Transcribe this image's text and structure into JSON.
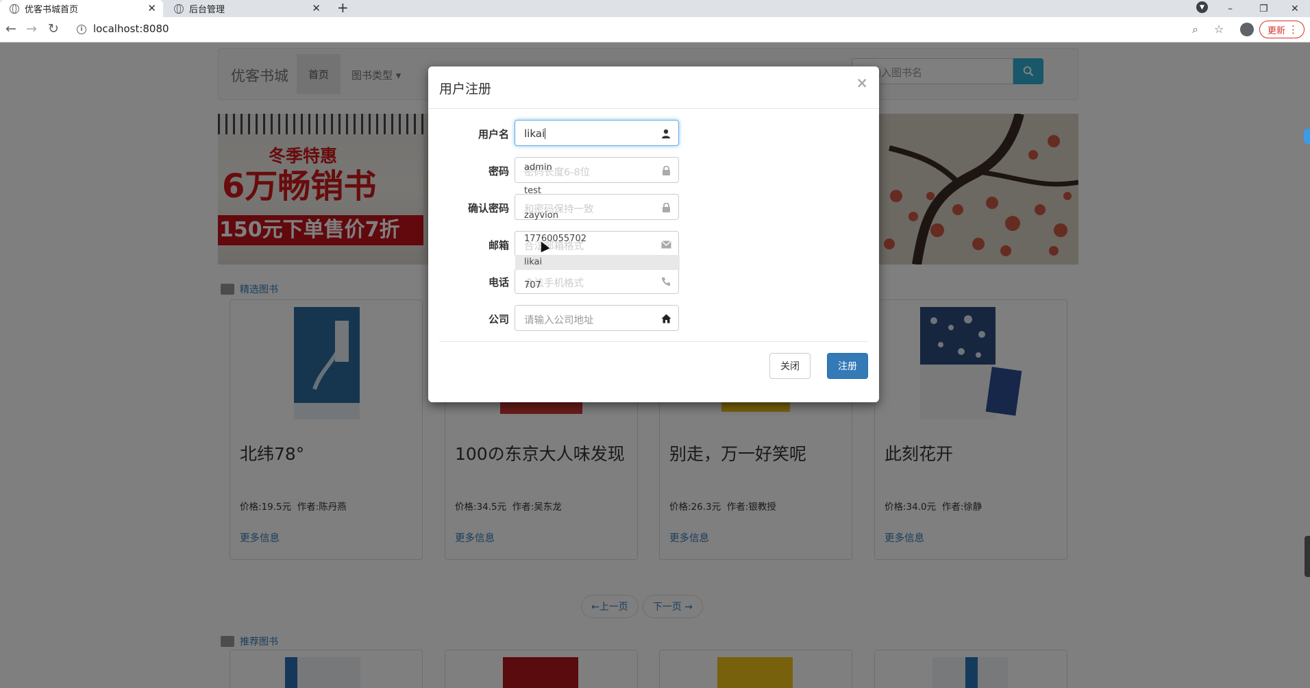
{
  "browser": {
    "tabs": [
      {
        "title": "优客书城首页",
        "active": true
      },
      {
        "title": "后台管理",
        "active": false
      }
    ],
    "new_tab": "+",
    "url": "localhost:8080",
    "update_label": "更新",
    "window_controls": {
      "minimize": "–",
      "restore": "❐",
      "close": "✕"
    }
  },
  "site": {
    "brand": "优客书城",
    "nav": {
      "home": "首页",
      "book_types": "图书类型 ▾"
    },
    "search_placeholder": "请输入图书名",
    "banner": {
      "line1": "冬季特惠",
      "line2": "6万畅销书",
      "line3": "150元下单售价7折"
    },
    "featured_title": "精选图书",
    "recommended_title": "推荐图书",
    "books": [
      {
        "title": "北纬78°",
        "price": "价格:19.5元",
        "author": "作者:陈丹燕",
        "more": "更多信息"
      },
      {
        "title": "100の东京大人味发现",
        "price": "价格:34.5元",
        "author": "作者:吴东龙",
        "more": "更多信息"
      },
      {
        "title": "别走，万一好笑呢",
        "price": "价格:26.3元",
        "author": "作者:银教授",
        "more": "更多信息"
      },
      {
        "title": "此刻花开",
        "price": "价格:34.0元",
        "author": "作者:徐静",
        "more": "更多信息"
      }
    ],
    "pager": {
      "prev": "←上一页",
      "next": "下一页 →"
    }
  },
  "modal": {
    "title": "用户注册",
    "close": "×",
    "fields": [
      {
        "label": "用户名",
        "value": "likai",
        "placeholder": "",
        "icon": "user-icon"
      },
      {
        "label": "密码",
        "value": "",
        "placeholder": "密码长度6-8位",
        "icon": "lock-icon"
      },
      {
        "label": "确认密码",
        "value": "",
        "placeholder": "和密码保持一致",
        "icon": "lock-icon"
      },
      {
        "label": "邮箱",
        "value": "",
        "placeholder": "合法邮箱格式",
        "icon": "envelope-icon"
      },
      {
        "label": "电话",
        "value": "",
        "placeholder": "合法手机格式",
        "icon": "phone-icon"
      },
      {
        "label": "公司",
        "value": "",
        "placeholder": "请输入公司地址",
        "icon": "home-icon"
      }
    ],
    "autocomplete": [
      "admin",
      "test",
      "zayvion",
      "17760055702",
      "likai",
      "707"
    ],
    "buttons": {
      "close": "关闭",
      "register": "注册"
    }
  },
  "colors": {
    "primary": "#337ab7",
    "search": "#31b0d5",
    "overlay": "rgba(0,0,0,0.5)"
  }
}
